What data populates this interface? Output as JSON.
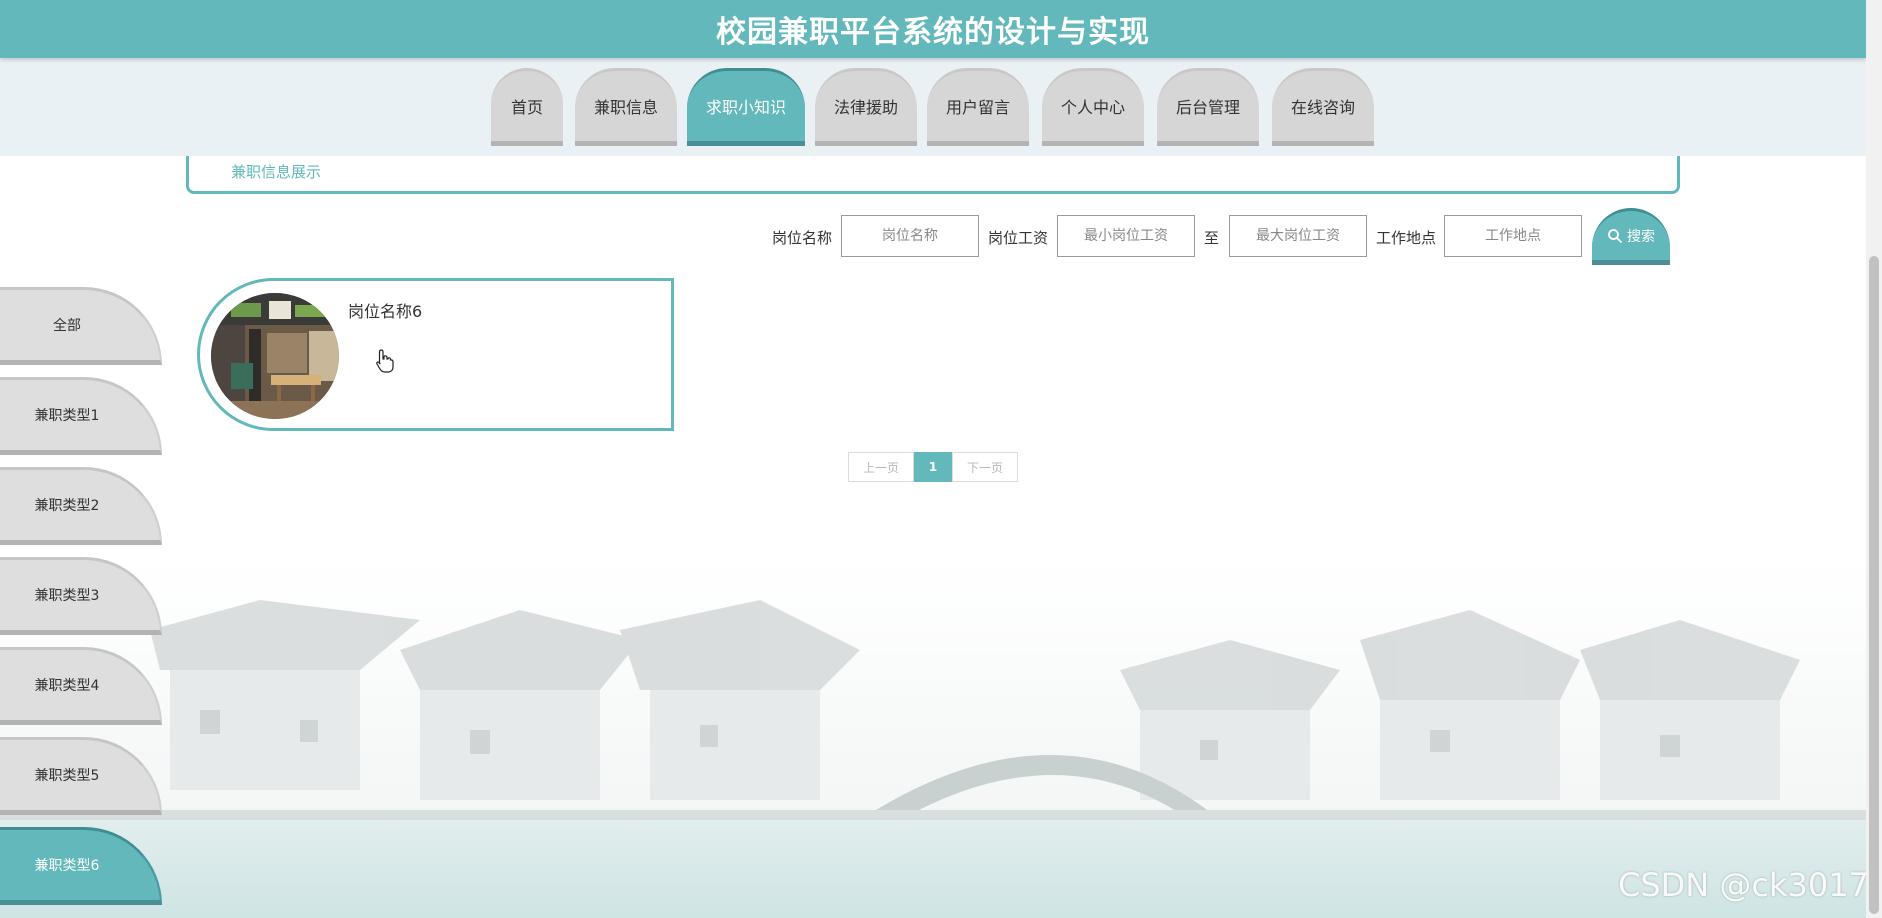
{
  "header": {
    "title": "校园兼职平台系统的设计与实现"
  },
  "nav": {
    "tabs": [
      {
        "label": "首页",
        "active": false
      },
      {
        "label": "兼职信息",
        "active": false
      },
      {
        "label": "求职小知识",
        "active": true
      },
      {
        "label": "法律援助",
        "active": false
      },
      {
        "label": "用户留言",
        "active": false
      },
      {
        "label": "个人中心",
        "active": false
      },
      {
        "label": "后台管理",
        "active": false
      },
      {
        "label": "在线咨询",
        "active": false
      }
    ]
  },
  "breadcrumb": {
    "text": "兼职信息展示"
  },
  "search": {
    "name_label": "岗位名称",
    "name_placeholder": "岗位名称",
    "salary_label": "岗位工资",
    "salary_min_placeholder": "最小岗位工资",
    "salary_to": "至",
    "salary_max_placeholder": "最大岗位工资",
    "location_label": "工作地点",
    "location_placeholder": "工作地点",
    "button_label": "搜索",
    "button_icon": "search-icon"
  },
  "categories": [
    {
      "label": "全部",
      "active": false
    },
    {
      "label": "兼职类型1",
      "active": false
    },
    {
      "label": "兼职类型2",
      "active": false
    },
    {
      "label": "兼职类型3",
      "active": false
    },
    {
      "label": "兼职类型4",
      "active": false
    },
    {
      "label": "兼职类型5",
      "active": false
    },
    {
      "label": "兼职类型6",
      "active": true
    }
  ],
  "job_card": {
    "title": "岗位名称6"
  },
  "pagination": {
    "prev": "上一页",
    "current": "1",
    "next": "下一页"
  },
  "watermark": "CSDN @ck3017",
  "colors": {
    "primary": "#62b8ba",
    "primary_dark": "#4a8f96",
    "tab_inactive": "#d6d6d6"
  }
}
